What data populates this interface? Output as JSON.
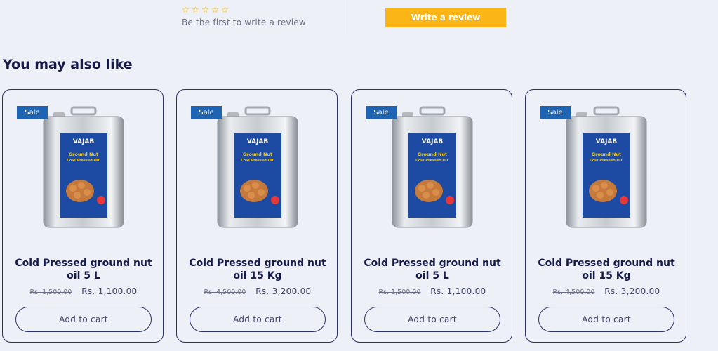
{
  "review": {
    "stars": [
      "☆",
      "☆",
      "☆",
      "☆",
      "☆"
    ],
    "prompt": "Be the first to write a review",
    "button_label": "Write a review",
    "star_color": "#f5b400",
    "button_color": "#fbb516"
  },
  "section": {
    "title": "You may also like"
  },
  "products": [
    {
      "badge": "Sale",
      "brand": "VAJAB",
      "label_lines": [
        "Ground Nut",
        "Cold Pressed OIL"
      ],
      "title": "Cold Pressed ground nut oil 5 L",
      "price_old": "Rs. 1,500.00",
      "price_new": "Rs. 1,100.00",
      "cart_label": "Add to cart"
    },
    {
      "badge": "Sale",
      "brand": "VAJAB",
      "label_lines": [
        "Ground Nut",
        "Cold Pressed OIL"
      ],
      "title": "Cold Pressed ground nut oil 15 Kg",
      "price_old": "Rs. 4,500.00",
      "price_new": "Rs. 3,200.00",
      "cart_label": "Add to cart"
    },
    {
      "badge": "Sale",
      "brand": "VAJAB",
      "label_lines": [
        "Ground Nut",
        "Cold Pressed OIL"
      ],
      "title": "Cold Pressed ground nut oil 5 L",
      "price_old": "Rs. 1,500.00",
      "price_new": "Rs. 1,100.00",
      "cart_label": "Add to cart"
    },
    {
      "badge": "Sale",
      "brand": "VAJAB",
      "label_lines": [
        "Ground Nut",
        "Cold Pressed OIL"
      ],
      "title": "Cold Pressed ground nut oil 15 Kg",
      "price_old": "Rs. 4,500.00",
      "price_new": "Rs. 3,200.00",
      "cart_label": "Add to cart"
    }
  ],
  "colors": {
    "badge": "#1f64b3",
    "label_blue": "#1d4aa3",
    "border": "#2c3266"
  }
}
